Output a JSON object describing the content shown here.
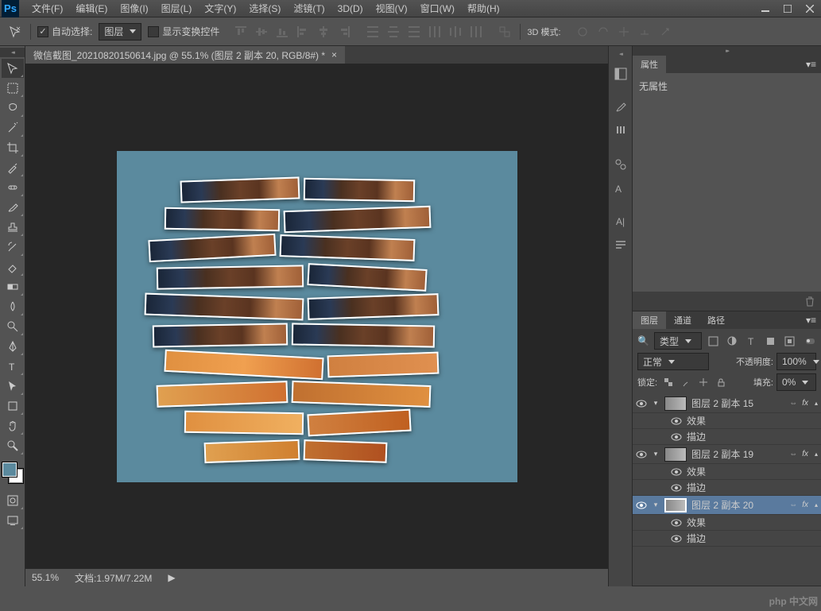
{
  "app": {
    "logo": "Ps"
  },
  "menu": [
    "文件(F)",
    "编辑(E)",
    "图像(I)",
    "图层(L)",
    "文字(Y)",
    "选择(S)",
    "滤镜(T)",
    "3D(D)",
    "视图(V)",
    "窗口(W)",
    "帮助(H)"
  ],
  "options": {
    "auto_select": "自动选择:",
    "layer_dropdown": "图层",
    "show_transform": "显示变换控件",
    "mode_3d_label": "3D 模式:"
  },
  "document": {
    "tab_title": "微信截图_20210820150614.jpg @ 55.1% (图层 2 副本 20, RGB/8#) *",
    "zoom": "55.1%",
    "doc_size_label": "文档:",
    "doc_size": "1.97M/7.22M",
    "canvas_bg": "#5b8a9e"
  },
  "properties": {
    "tab": "属性",
    "content": "无属性"
  },
  "layers_panel": {
    "tabs": [
      "图层",
      "通道",
      "路径"
    ],
    "filter_label": "类型",
    "blend_mode": "正常",
    "opacity_label": "不透明度:",
    "opacity_value": "100%",
    "lock_label": "锁定:",
    "fill_label": "填充:",
    "fill_value": "0%",
    "effects_label": "效果",
    "stroke_label": "描边",
    "link_icon": "⇔",
    "fx_label": "fx",
    "layers": [
      {
        "name": "图层 2 副本 15",
        "selected": false
      },
      {
        "name": "图层 2 副本 19",
        "selected": false
      },
      {
        "name": "图层 2 副本 20",
        "selected": true
      }
    ]
  },
  "watermark": "php 中文网"
}
